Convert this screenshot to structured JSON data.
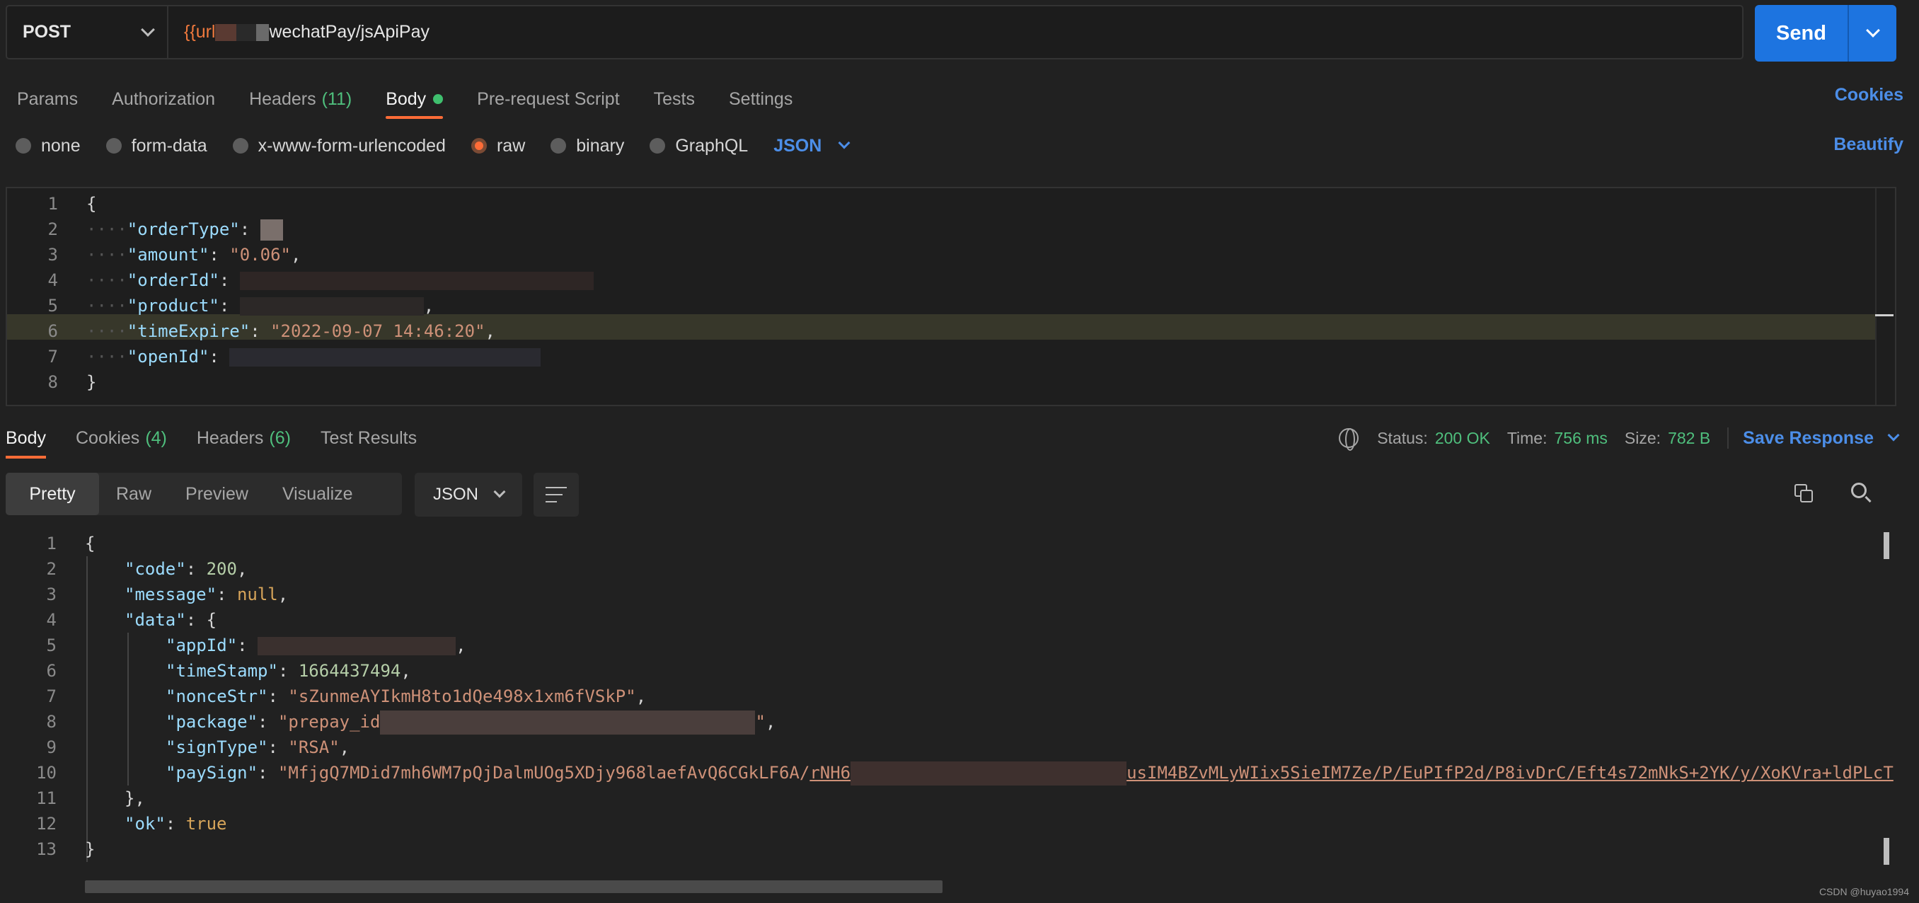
{
  "request": {
    "method": "POST",
    "url_var": "{{url",
    "url_path": "wechatPay/jsApiPay",
    "send_label": "Send"
  },
  "req_tabs": [
    {
      "label": "Params"
    },
    {
      "label": "Authorization"
    },
    {
      "label": "Headers",
      "count": "(11)"
    },
    {
      "label": "Body"
    },
    {
      "label": "Pre-request Script"
    },
    {
      "label": "Tests"
    },
    {
      "label": "Settings"
    }
  ],
  "cookies_label": "Cookies",
  "body_types": [
    "none",
    "form-data",
    "x-www-form-urlencoded",
    "raw",
    "binary",
    "GraphQL"
  ],
  "body_format": "JSON",
  "beautify_label": "Beautify",
  "request_body": {
    "line_numbers": [
      "1",
      "2",
      "3",
      "4",
      "5",
      "6",
      "7",
      "8"
    ],
    "open": "{",
    "close": "}",
    "k_orderType": "\"orderType\"",
    "k_amount": "\"amount\"",
    "v_amount": "\"0.06\"",
    "k_orderId": "\"orderId\"",
    "k_product": "\"product\"",
    "k_timeExpire": "\"timeExpire\"",
    "v_timeExpire": "\"2022-09-07 14:46:20\"",
    "k_openId": "\"openId\""
  },
  "resp_tabs": [
    {
      "label": "Body"
    },
    {
      "label": "Cookies",
      "count": "(4)"
    },
    {
      "label": "Headers",
      "count": "(6)"
    },
    {
      "label": "Test Results"
    }
  ],
  "status": {
    "status_label": "Status:",
    "status_value": "200 OK",
    "time_label": "Time:",
    "time_value": "756 ms",
    "size_label": "Size:",
    "size_value": "782 B",
    "save_label": "Save Response"
  },
  "view_modes": [
    "Pretty",
    "Raw",
    "Preview",
    "Visualize"
  ],
  "response_format": "JSON",
  "response_body": {
    "line_numbers": [
      "1",
      "2",
      "3",
      "4",
      "5",
      "6",
      "7",
      "8",
      "9",
      "10",
      "11",
      "12",
      "13"
    ],
    "k_code": "\"code\"",
    "v_code": "200",
    "k_message": "\"message\"",
    "v_message": "null",
    "k_data": "\"data\"",
    "k_appId": "\"appId\"",
    "k_timeStamp": "\"timeStamp\"",
    "v_timeStamp": "1664437494",
    "k_nonceStr": "\"nonceStr\"",
    "v_nonceStr": "\"sZunmeAYIkmH8to1dQe498x1xm6fVSkP\"",
    "k_package": "\"package\"",
    "v_package_a": "\"prepay_id",
    "v_package_b": "\"",
    "k_signType": "\"signType\"",
    "v_signType": "\"RSA\"",
    "k_paySign": "\"paySign\"",
    "v_paySign_a": "\"MfjgQ7MDid7mh6WM7pQjDalmUOg5XDjy968laefAvQ6CGkLF6A/",
    "v_paySign_b": "rNH6",
    "v_paySign_c": "usIM4BZvMLyWIix5SieIM7Ze/P/EuPIfP2d/P8ivDrC/Eft4s72mNkS+2YK/y/XoKVra+ldPLcT",
    "k_ok": "\"ok\"",
    "v_ok": "true"
  },
  "watermark": "CSDN @huyao1994"
}
